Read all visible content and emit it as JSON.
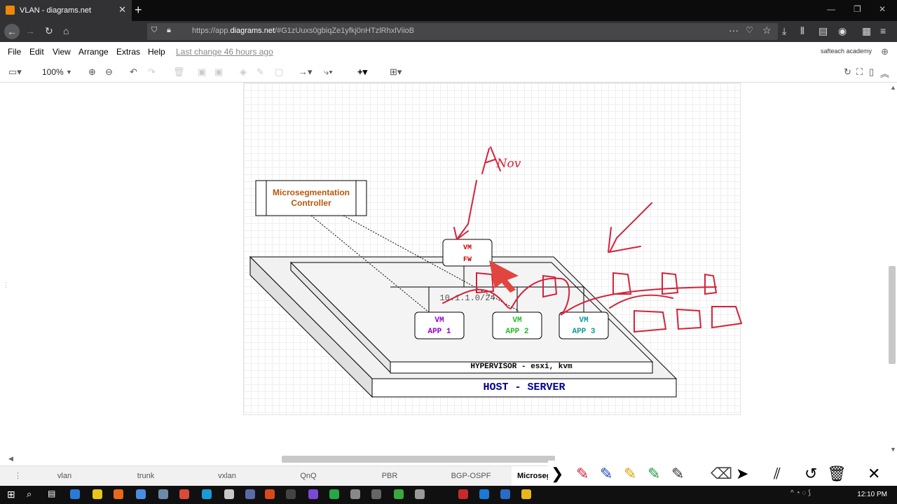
{
  "browser": {
    "tab_title": "VLAN - diagrams.net",
    "url_prefix": "https://app.",
    "url_domain": "diagrams.net",
    "url_rest": "/#G1zUuxs0gbiqZe1yfkj0nHTzlRhxlViioB"
  },
  "menu": {
    "items": [
      "File",
      "Edit",
      "View",
      "Arrange",
      "Extras",
      "Help"
    ],
    "last_change": "Last change 46 hours ago",
    "user": "safteach academy"
  },
  "toolbar": {
    "zoom": "100%"
  },
  "diagram": {
    "controller_label": "Microsegmentation Controller",
    "vm_fw": [
      "VM",
      "FW"
    ],
    "subnet": "10.1.1.0/24",
    "app1": [
      "VM",
      "APP 1"
    ],
    "app2": [
      "VM",
      "APP 2"
    ],
    "app3": [
      "VM",
      "APP 3"
    ],
    "hypervisor": "HYPERVISOR - esxi, kvm",
    "host": "HOST - SERVER",
    "handwriting": "Nov",
    "colors": {
      "app1": "#9400d3",
      "app2": "#22bb22",
      "app3": "#119999",
      "host": "#00008b",
      "controller": "#b8560b",
      "ink": "#d4223a"
    }
  },
  "sheets": [
    "vlan",
    "trunk",
    "vxlan",
    "QnQ",
    "PBR",
    "BGP-OSPF",
    "Microseg"
  ],
  "taskbar": {
    "time": "12:10 PM"
  }
}
